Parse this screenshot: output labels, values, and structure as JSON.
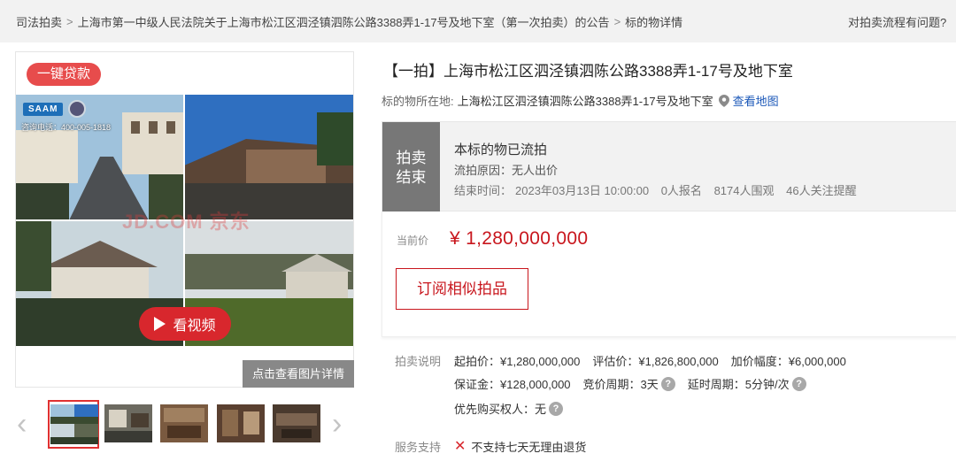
{
  "breadcrumb": {
    "items": [
      "司法拍卖",
      "上海市第一中级人民法院关于上海市松江区泗泾镇泗陈公路3388弄1-17号及地下室（第一次拍卖）的公告",
      "标的物详情"
    ],
    "separator": ">",
    "help": "对拍卖流程有问题?"
  },
  "gallery": {
    "loan_badge": "一键贷款",
    "logo_text": "SAAM",
    "hotline": "咨询电话：400-005-1818",
    "watermark": "JD.COM 京东",
    "video_label": "看视频",
    "detail_label": "点击查看图片详情",
    "thumbs_count": 5
  },
  "item": {
    "title": "【一拍】上海市松江区泗泾镇泗陈公路3388弄1-17号及地下室",
    "location_label": "标的物所在地:",
    "location_value": "上海松江区泗泾镇泗陈公路3388弄1-17号及地下室",
    "map_link": "查看地图"
  },
  "status": {
    "tag_line1": "拍卖",
    "tag_line2": "结束",
    "main": "本标的物已流拍",
    "reason": "流拍原因：无人出价",
    "end_time_label": "结束时间：",
    "end_time": "2023年03月13日 10:00:00",
    "signups": "0人报名",
    "viewers": "8174人围观",
    "followers": "46人关注提醒"
  },
  "price": {
    "label": "当前价",
    "value": "¥ 1,280,000,000",
    "subscribe": "订阅相似拍品"
  },
  "rules": {
    "label": "拍卖说明",
    "start_price": "起拍价：¥1,280,000,000",
    "appraisal": "评估价：¥1,826,800,000",
    "increment": "加价幅度：¥6,000,000",
    "deposit": "保证金：¥128,000,000",
    "bid_period": "竞价周期：3天",
    "delay_period": "延时周期：5分钟/次",
    "priority": "优先购买权人：无"
  },
  "service": {
    "label": "服务支持",
    "no_return": "不支持七天无理由退货"
  },
  "colors": {
    "accent_red": "#c8161d",
    "link_blue": "#1a57b8",
    "status_gray": "#777777"
  }
}
